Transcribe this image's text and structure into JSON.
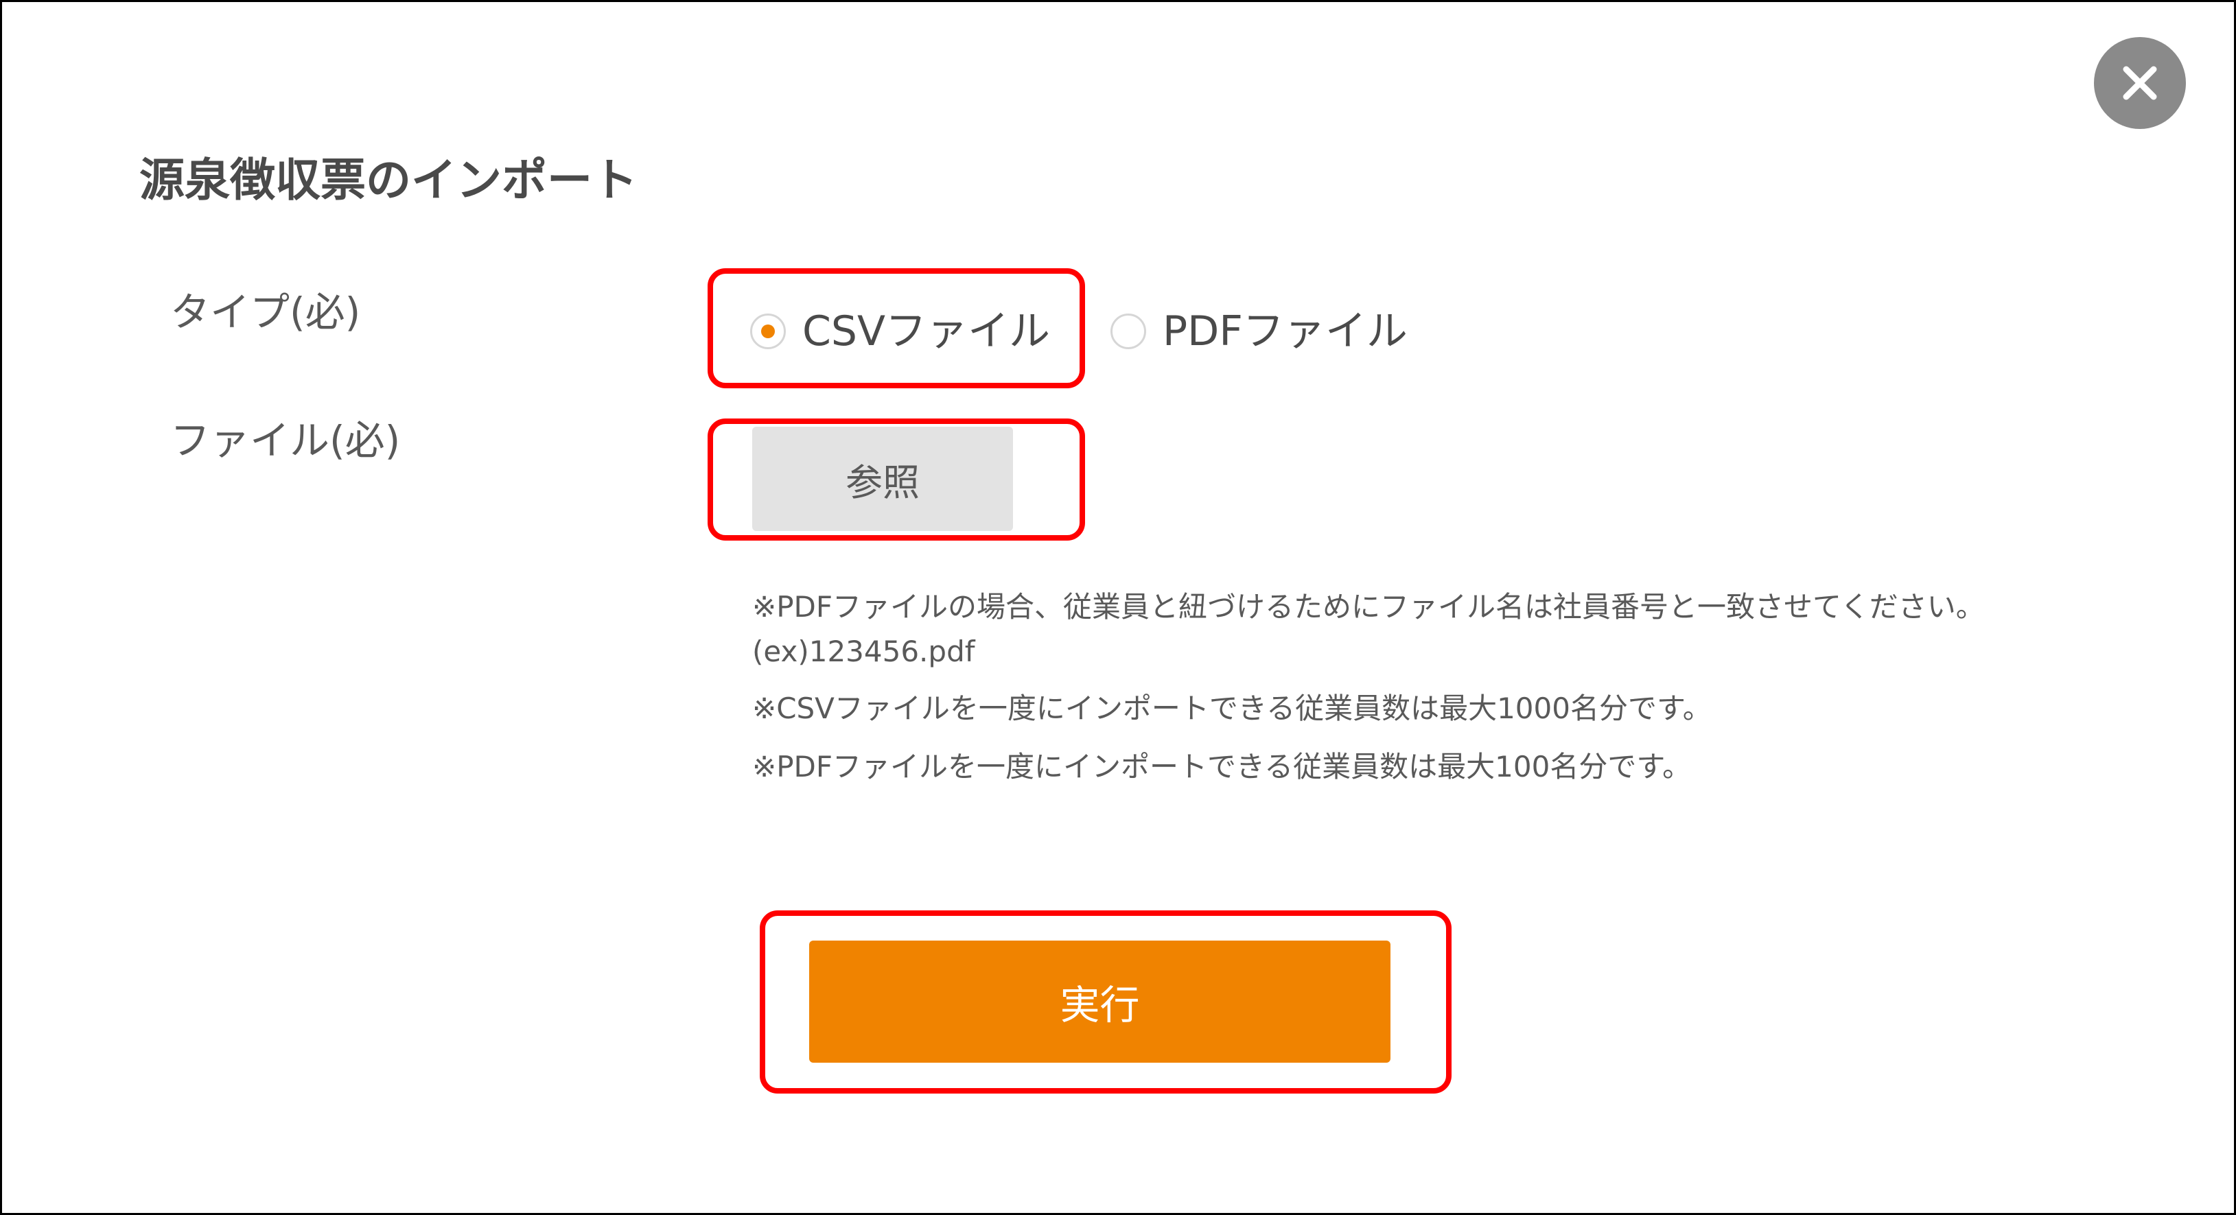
{
  "dialog": {
    "title": "源泉徴収票のインポート",
    "close_icon": "close-icon"
  },
  "form": {
    "type_label": "タイプ(必)",
    "file_label": "ファイル(必)",
    "type_options": [
      {
        "label": "CSVファイル",
        "selected": true
      },
      {
        "label": "PDFファイル",
        "selected": false
      }
    ],
    "browse_label": "参照"
  },
  "notes": [
    "※PDFファイルの場合、従業員と紐づけるためにファイル名は社員番号と一致させてください。",
    "(ex)123456.pdf",
    "※CSVファイルを一度にインポートできる従業員数は最大1000名分です。",
    "※PDFファイルを一度にインポートできる従業員数は最大100名分です。"
  ],
  "actions": {
    "run_label": "実行"
  },
  "colors": {
    "accent": "#f08300",
    "highlight": "#ff0000",
    "close_button": "#8a8a8a",
    "browse_button": "#e3e3e3"
  }
}
